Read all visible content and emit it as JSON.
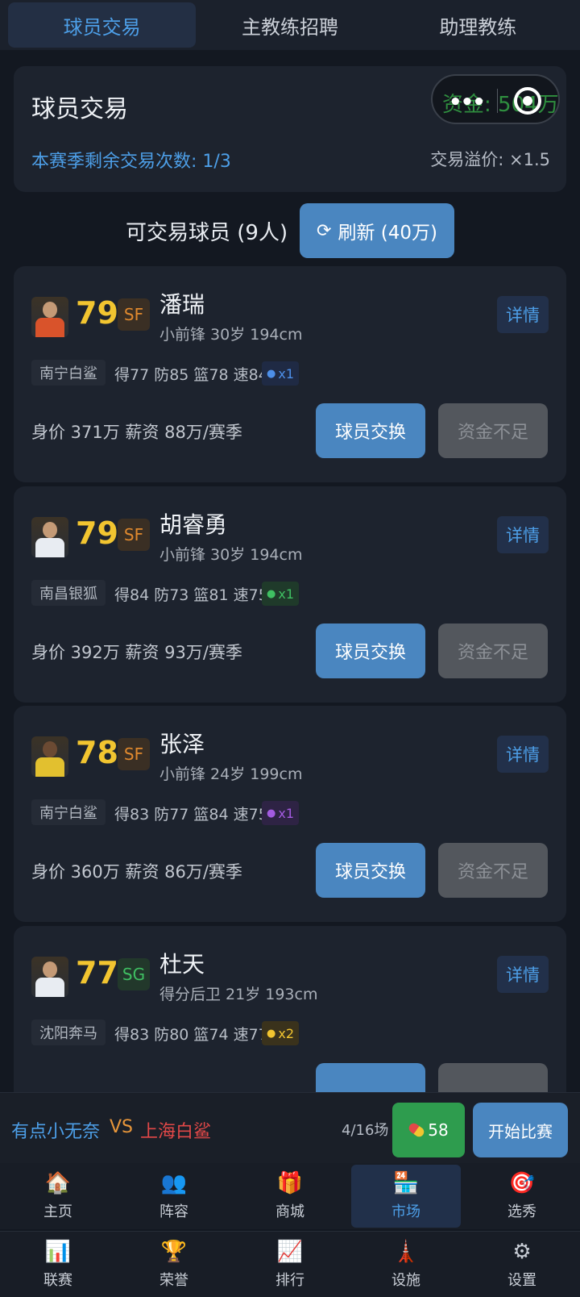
{
  "top_tabs": [
    "球员交易",
    "主教练招聘",
    "助理教练"
  ],
  "panel": {
    "title": "球员交易",
    "funds": "资金: 504万",
    "trades_left": "本赛季剩余交易次数: 1/3",
    "premium": "交易溢价: ×1.5"
  },
  "section": {
    "title": "可交易球员 (9人)",
    "refresh_label": "刷新 (40万)"
  },
  "detail_label": "详情",
  "trade_label": "球员交换",
  "nofunds_label": "资金不足",
  "players": [
    {
      "rating": "79",
      "pos": "SF",
      "name": "潘瑞",
      "sub": "小前锋 30岁 194cm",
      "team": "南宁白鲨",
      "stats": "得77 防85 篮78 速84",
      "mult": "x1",
      "value": "身价 371万   薪资 88万/赛季"
    },
    {
      "rating": "79",
      "pos": "SF",
      "name": "胡睿勇",
      "sub": "小前锋 30岁 194cm",
      "team": "南昌银狐",
      "stats": "得84 防73 篮81 速75",
      "mult": "x1",
      "value": "身价 392万   薪资 93万/赛季"
    },
    {
      "rating": "78",
      "pos": "SF",
      "name": "张泽",
      "sub": "小前锋 24岁 199cm",
      "team": "南宁白鲨",
      "stats": "得83 防77 篮84 速75",
      "mult": "x1",
      "value": "身价 360万   薪资 86万/赛季"
    },
    {
      "rating": "77",
      "pos": "SG",
      "name": "杜天",
      "sub": "得分后卫 21岁 193cm",
      "team": "沈阳奔马",
      "stats": "得83 防80 篮74 速77",
      "mult": "x2",
      "value": ""
    }
  ],
  "match": {
    "home": "有点小无奈",
    "vs": "VS",
    "away": "上海白鲨",
    "round": "4/16场",
    "energy": "58",
    "start": "开始比赛"
  },
  "nav_row1": [
    {
      "label": "主页",
      "icon": "home-icon",
      "glyph": "🏠"
    },
    {
      "label": "阵容",
      "icon": "roster-icon",
      "glyph": "👥"
    },
    {
      "label": "商城",
      "icon": "gift-icon",
      "glyph": "🎁"
    },
    {
      "label": "市场",
      "icon": "market-icon",
      "glyph": "🏪"
    },
    {
      "label": "选秀",
      "icon": "target-icon",
      "glyph": "🎯"
    }
  ],
  "nav_row2": [
    {
      "label": "联赛",
      "icon": "league-chart-icon",
      "glyph": "📊"
    },
    {
      "label": "荣誉",
      "icon": "trophy-icon",
      "glyph": "🏆"
    },
    {
      "label": "排行",
      "icon": "ranking-icon",
      "glyph": "📈"
    },
    {
      "label": "设施",
      "icon": "facility-icon",
      "glyph": "🗼"
    },
    {
      "label": "设置",
      "icon": "gear-icon",
      "glyph": "⚙"
    }
  ],
  "colors": {
    "accent": "#4d9fe8",
    "rating": "#f2c530",
    "sf": "#e0892e",
    "sg": "#3fbf62",
    "mult_blue": "#4d8fe8",
    "mult_green": "#3fbf62",
    "mult_purple": "#a35be0",
    "mult_gold": "#f2c530"
  }
}
